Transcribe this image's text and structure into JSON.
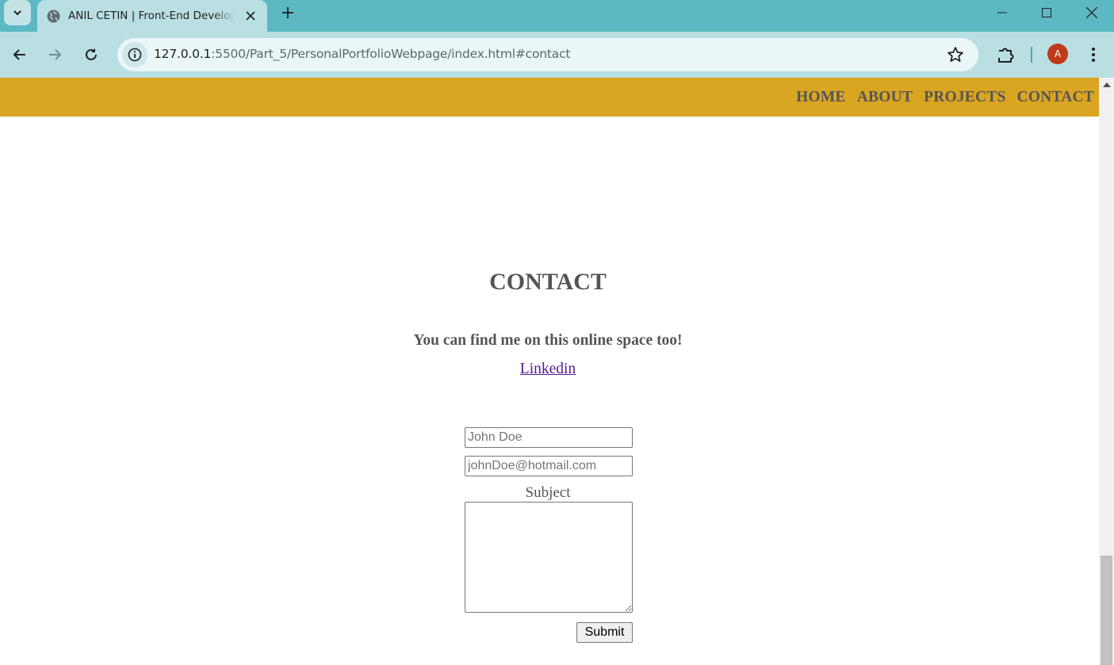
{
  "browser": {
    "tab_title": "ANIL CETIN | Front-End Developer",
    "url_host": "127.0.0.1",
    "url_rest": ":5500/Part_5/PersonalPortfolioWebpage/index.html#contact",
    "profile_initial": "A",
    "colors": {
      "tabstrip": "#5cb8c2",
      "toolbar": "#b9dfe3",
      "avatar": "#c0391b"
    }
  },
  "nav": {
    "items": [
      {
        "label": "HOME"
      },
      {
        "label": "ABOUT"
      },
      {
        "label": "PROJECTS"
      },
      {
        "label": "CONTACT"
      }
    ],
    "color": "#daa520"
  },
  "contact": {
    "title": "CONTACT",
    "subtitle": "You can find me on this online space too!",
    "link_label": "Linkedin",
    "form": {
      "name_placeholder": "John Doe",
      "email_placeholder": "johnDoe@hotmail.com",
      "subject_label": "Subject",
      "submit_label": "Submit"
    }
  }
}
